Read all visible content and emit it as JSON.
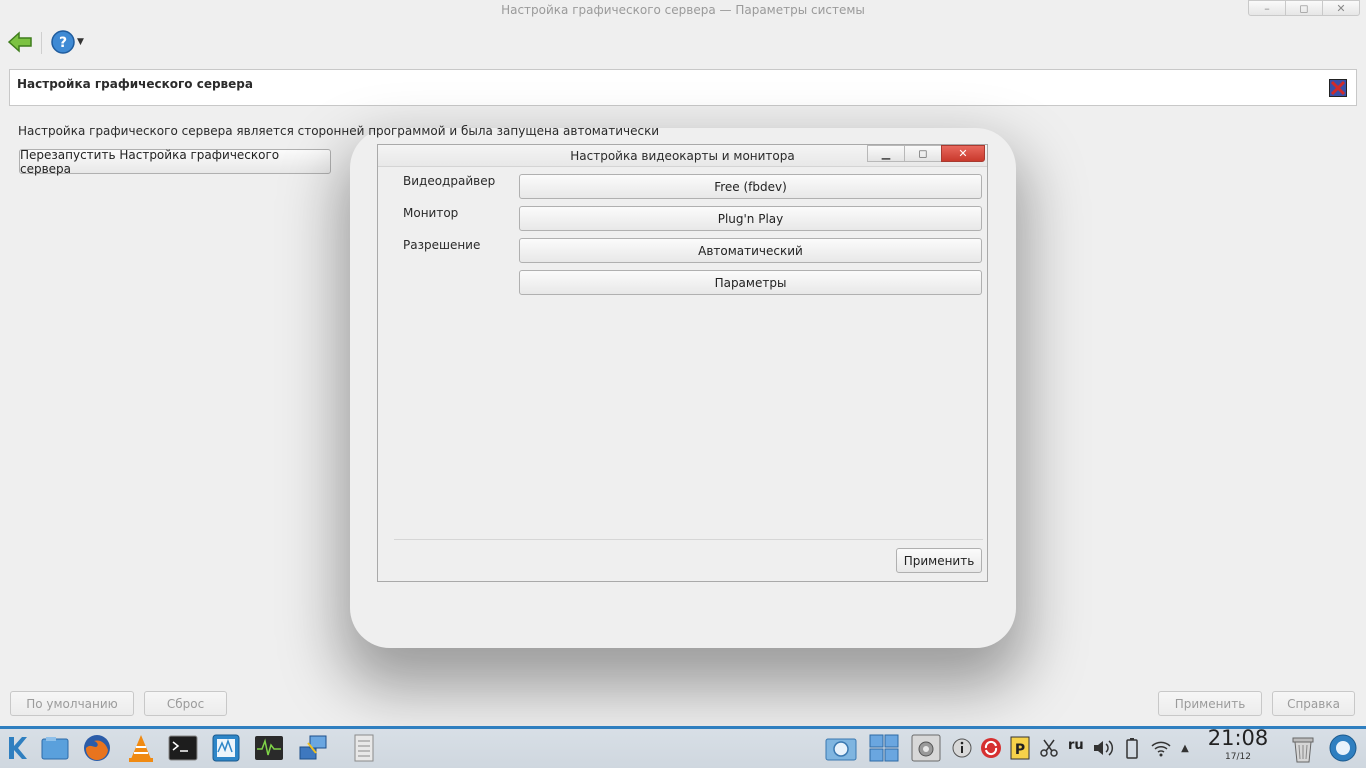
{
  "window": {
    "title": "Настройка графического сервера — Параметры системы",
    "controls": [
      "–",
      "◻",
      "✕"
    ]
  },
  "toolbar": {
    "back_icon": "back-arrow-icon",
    "help_icon": "help-icon"
  },
  "header": {
    "title": "Настройка графического сервера"
  },
  "main": {
    "info_text": "Настройка графического сервера является сторонней программой и была запущена автоматически",
    "restart_button": "Перезапустить Настройка графического сервера"
  },
  "bottom": {
    "defaults_button": "По умолчанию",
    "reset_button": "Сброс",
    "apply_button": "Применить",
    "help_button": "Справка"
  },
  "dialog": {
    "title": "Настройка видеокарты и монитора",
    "controls": [
      "▁",
      "◻",
      "✕"
    ],
    "labels": {
      "videodriver": "Видеодрайвер",
      "monitor": "Монитор",
      "resolution": "Разрешение"
    },
    "fields": {
      "videodriver": "Free (fbdev)",
      "monitor": "Plug'n Play",
      "resolution": "Автоматический",
      "parameters": "Параметры"
    },
    "apply_button": "Применить"
  },
  "taskbar": {
    "tray_lang": "ru",
    "time": "21:08",
    "date": "17/12"
  },
  "colors": {
    "accent_blue": "#2f7fc0",
    "close_red": "#d0463a"
  }
}
